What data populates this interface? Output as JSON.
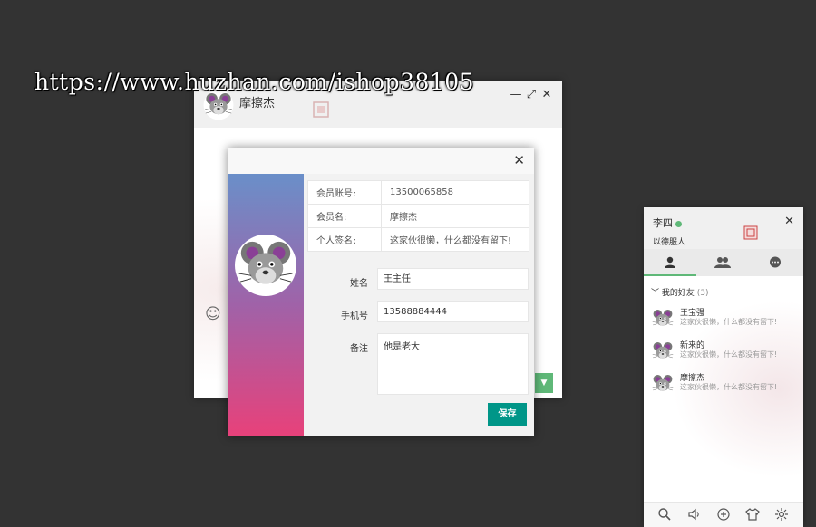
{
  "watermark": "https://www.huzhan.com/ishop38105",
  "chat": {
    "name": "摩擦杰",
    "controls": {
      "minimize": "—",
      "maximize": "⤢",
      "close": "✕"
    },
    "emoji_glyph": "☺",
    "send_dropdown_glyph": "▼"
  },
  "modal": {
    "close_glyph": "✕",
    "info": [
      {
        "key": "会员账号:",
        "value": "13500065858"
      },
      {
        "key": "会员名:",
        "value": "摩擦杰"
      },
      {
        "key": "个人签名:",
        "value": "这家伙很懒，什么都没有留下!"
      }
    ],
    "form": {
      "name_label": "姓名",
      "name_value": "王主任",
      "phone_label": "手机号",
      "phone_value": "13588884444",
      "note_label": "备注",
      "note_value": "他是老大"
    },
    "save_label": "保存"
  },
  "panel": {
    "user_name": "李四",
    "signature": "以德服人",
    "close_glyph": "✕",
    "group": {
      "chevron": "﹀",
      "name": "我的好友",
      "count": "(3)"
    },
    "friends": [
      {
        "name": "王宝强",
        "sign": "这家伙很懒，什么都没有留下!"
      },
      {
        "name": "新来的",
        "sign": "这家伙很懒，什么都没有留下!"
      },
      {
        "name": "摩擦杰",
        "sign": "这家伙很懒，什么都没有留下!"
      }
    ]
  },
  "colors": {
    "background": "#333333",
    "accent_green": "#5fb878",
    "save_teal": "#009688",
    "gradient_top": "#6a8fc9",
    "gradient_bottom": "#e8417a"
  }
}
